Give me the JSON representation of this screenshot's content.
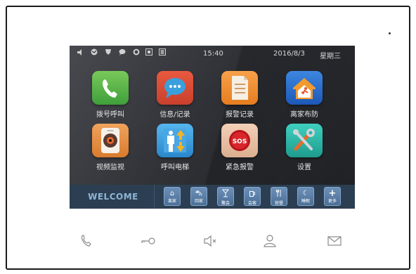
{
  "status": {
    "time": "15:40",
    "date": "2016/8/3",
    "weekday": "星期三",
    "icons": [
      "speaker-icon",
      "globe-icon",
      "shield-icon",
      "message-icon",
      "refresh-icon",
      "calendar-icon",
      "storage-icon"
    ]
  },
  "apps": [
    {
      "label": "拨号呼叫",
      "icon": "phone-icon",
      "color": "#4caf50"
    },
    {
      "label": "信息/记录",
      "icon": "chat-bubble-icon",
      "color": "#2196c9"
    },
    {
      "label": "报警记录",
      "icon": "document-icon",
      "color": "#f08a24"
    },
    {
      "label": "离家布防",
      "icon": "house-shield-icon",
      "color": "#2a6fd1"
    },
    {
      "label": "视频监视",
      "icon": "camera-icon",
      "color": "#e08a42"
    },
    {
      "label": "呼叫电梯",
      "icon": "elevator-icon",
      "color": "#39a2e0"
    },
    {
      "label": "紧急报警",
      "icon": "sos-icon",
      "color": "#e8bfa6"
    },
    {
      "label": "设置",
      "icon": "tools-icon",
      "color": "#2eb5a6"
    }
  ],
  "bottom": {
    "welcome": "WELCOME",
    "quick": [
      {
        "label": "离家",
        "icon": "home-leave-icon",
        "glyph": "⌂"
      },
      {
        "label": "回家",
        "icon": "car-icon",
        "glyph": "⛍"
      },
      {
        "label": "聚会",
        "icon": "cocktail-icon",
        "glyph": "🍸"
      },
      {
        "label": "会客",
        "icon": "cup-icon",
        "glyph": "☕"
      },
      {
        "label": "就餐",
        "icon": "utensils-icon",
        "glyph": "✕"
      },
      {
        "label": "睡眠",
        "icon": "moon-icon",
        "glyph": "☾"
      },
      {
        "label": "更多",
        "icon": "plus-icon",
        "glyph": "+"
      }
    ]
  },
  "hardware_buttons": [
    "phone-icon",
    "key-icon",
    "speaker-mute-icon",
    "user-icon",
    "mail-icon"
  ]
}
